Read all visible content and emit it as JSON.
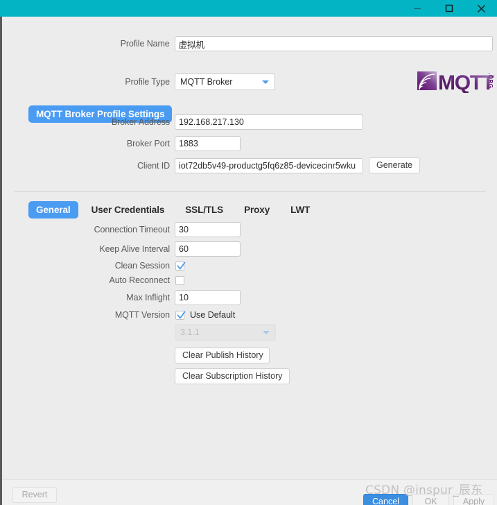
{
  "window": {
    "titlebar_color": "#03b5c4",
    "controls": [
      {
        "name": "minimize",
        "glyph": "minimize-icon"
      },
      {
        "name": "maximize",
        "glyph": "maximize-icon"
      },
      {
        "name": "close",
        "glyph": "close-icon"
      }
    ]
  },
  "theme": {
    "accent_blue": "#4a9bf2",
    "primary_button": "#3c8ee0",
    "background": "#ececed",
    "label_color": "#5a5a5a"
  },
  "profile": {
    "name_label": "Profile Name",
    "name_value": "虚拟机",
    "type_label": "Profile Type",
    "type_value": "MQTT Broker",
    "type_options": [
      "MQTT Broker"
    ]
  },
  "logo": {
    "text": "MQTT",
    "suffix": ".ORG",
    "name": "mqtt-org-logo"
  },
  "section": {
    "pill_label": "MQTT Broker Profile Settings",
    "broker_address_label": "Broker Address",
    "broker_address_value": "192.168.217.130",
    "broker_port_label": "Broker Port",
    "broker_port_value": "1883",
    "client_id_label": "Client ID",
    "client_id_value": "iot72db5v49-productg5fq6z85-devicecinr5wku",
    "generate_label": "Generate"
  },
  "tabs": [
    {
      "label": "General",
      "active": true
    },
    {
      "label": "User Credentials",
      "active": false
    },
    {
      "label": "SSL/TLS",
      "active": false
    },
    {
      "label": "Proxy",
      "active": false
    },
    {
      "label": "LWT",
      "active": false
    }
  ],
  "general": {
    "connection_timeout_label": "Connection Timeout",
    "connection_timeout_value": "30",
    "keep_alive_label": "Keep Alive Interval",
    "keep_alive_value": "60",
    "clean_session_label": "Clean Session",
    "clean_session_checked": true,
    "auto_reconnect_label": "Auto Reconnect",
    "auto_reconnect_checked": false,
    "max_inflight_label": "Max Inflight",
    "max_inflight_value": "10",
    "mqtt_version_label": "MQTT Version",
    "use_default_label": "Use Default",
    "use_default_checked": true,
    "version_value": "3.1.1",
    "version_options": [
      "3.1.1"
    ],
    "clear_publish_label": "Clear Publish History",
    "clear_subscription_label": "Clear Subscription History"
  },
  "footer": {
    "revert_label": "Revert",
    "cancel_label": "Cancel",
    "ok_label": "OK",
    "apply_label": "Apply"
  },
  "watermark": {
    "text": "CSDN @inspur_辰东"
  }
}
